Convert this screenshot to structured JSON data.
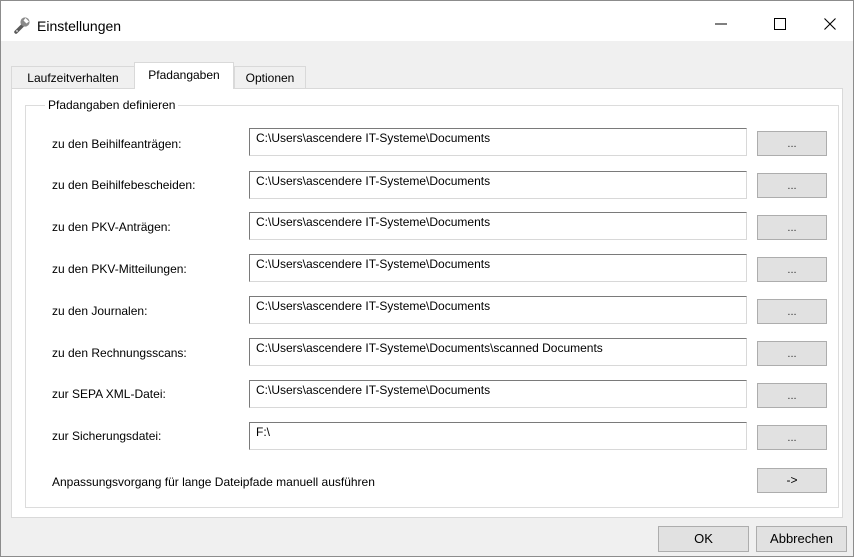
{
  "window": {
    "title": "Einstellungen",
    "icon": "wrench-icon",
    "controls": [
      "minimize-icon",
      "maximize-icon",
      "close-icon"
    ]
  },
  "tabs": [
    {
      "label": "Laufzeitverhalten",
      "active": false
    },
    {
      "label": "Pfadangaben",
      "active": true
    },
    {
      "label": "Optionen",
      "active": false
    }
  ],
  "group": {
    "title": "Pfadangaben definieren",
    "rows": [
      {
        "label": "zu den Beihilfeanträgen:",
        "value": "C:\\Users\\ascendere IT-Systeme\\Documents",
        "button": "..."
      },
      {
        "label": "zu den Beihilfebescheiden:",
        "value": "C:\\Users\\ascendere IT-Systeme\\Documents",
        "button": "..."
      },
      {
        "label": "zu den PKV-Anträgen:",
        "value": "C:\\Users\\ascendere IT-Systeme\\Documents",
        "button": "..."
      },
      {
        "label": "zu den PKV-Mitteilungen:",
        "value": "C:\\Users\\ascendere IT-Systeme\\Documents",
        "button": "..."
      },
      {
        "label": "zu den Journalen:",
        "value": "C:\\Users\\ascendere IT-Systeme\\Documents",
        "button": "..."
      },
      {
        "label": "zu den Rechnungsscans:",
        "value": "C:\\Users\\ascendere IT-Systeme\\Documents\\scanned Documents",
        "button": "..."
      },
      {
        "label": "zur SEPA XML-Datei:",
        "value": "C:\\Users\\ascendere IT-Systeme\\Documents",
        "button": "..."
      },
      {
        "label": "zur Sicherungsdatei:",
        "value": "F:\\",
        "button": "..."
      }
    ],
    "action": {
      "label": "Anpassungsvorgang für lange Dateipfade manuell ausführen",
      "button": "->"
    }
  },
  "footer": {
    "ok": "OK",
    "cancel": "Abbrechen"
  }
}
